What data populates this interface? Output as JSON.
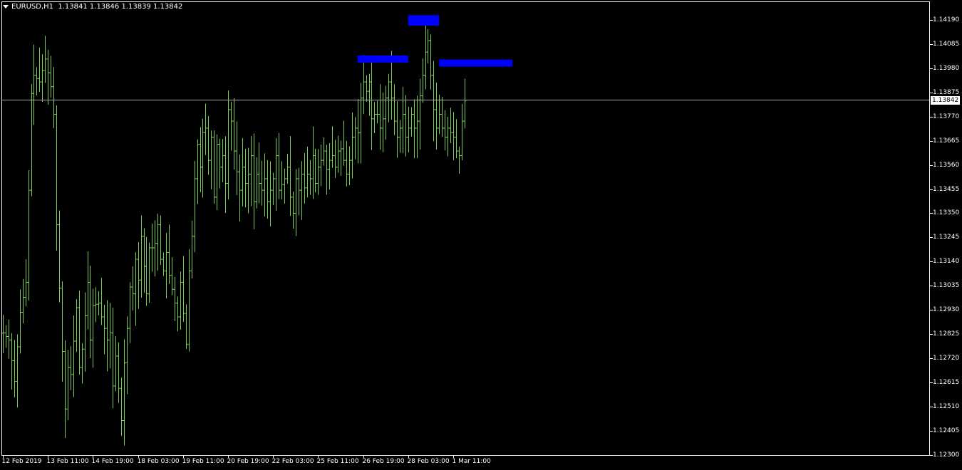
{
  "header": {
    "symbol": "EURUSD,H1",
    "quote": "1.13841 1.13846 1.13839 1.13842"
  },
  "current_price_label": "1.13842",
  "colors": {
    "background": "#000000",
    "bars": "#7ccc5c",
    "zones": "#0000ff",
    "axis": "#ffffff",
    "price_line": "#a8a8a8"
  },
  "chart_data": {
    "type": "bar",
    "title": "EURUSD,H1",
    "ylim": [
      1.123,
      1.1427
    ],
    "yticks": [
      "1.14190",
      "1.14085",
      "1.13980",
      "1.13875",
      "1.13770",
      "1.13665",
      "1.13560",
      "1.13455",
      "1.13350",
      "1.13245",
      "1.13140",
      "1.13035",
      "1.12930",
      "1.12825",
      "1.12720",
      "1.12615",
      "1.12510",
      "1.12405",
      "1.12300"
    ],
    "xticks": [
      "12 Feb 2019",
      "13 Feb 11:00",
      "14 Feb 19:00",
      "18 Feb 03:00",
      "19 Feb 11:00",
      "20 Feb 19:00",
      "22 Feb 03:00",
      "25 Feb 11:00",
      "26 Feb 19:00",
      "28 Feb 03:00",
      "1 Mar 11:00"
    ],
    "current_price": 1.13842,
    "zones": [
      {
        "from_bar": 126,
        "to_bar": 144,
        "low": 1.14015,
        "high": 1.14025
      },
      {
        "from_bar": 144,
        "to_bar": 155,
        "low": 1.14165,
        "high": 1.1421
      },
      {
        "from_bar": 155,
        "to_bar": 181,
        "low": 1.13995,
        "high": 1.1401
      }
    ],
    "anchors": [
      [
        0,
        1.1283
      ],
      [
        2,
        1.128
      ],
      [
        4,
        1.1262
      ],
      [
        6,
        1.1292
      ],
      [
        8,
        1.1305
      ],
      [
        9,
        1.1345
      ],
      [
        10,
        1.1387
      ],
      [
        11,
        1.1395
      ],
      [
        13,
        1.1392
      ],
      [
        15,
        1.1402
      ],
      [
        17,
        1.139
      ],
      [
        18,
        1.1378
      ],
      [
        19,
        1.133
      ],
      [
        21,
        1.1275
      ],
      [
        22,
        1.125
      ],
      [
        23,
        1.1268
      ],
      [
        24,
        1.1265
      ],
      [
        26,
        1.1294
      ],
      [
        27,
        1.1268
      ],
      [
        28,
        1.1276
      ],
      [
        30,
        1.1305
      ],
      [
        31,
        1.128
      ],
      [
        32,
        1.1295
      ],
      [
        34,
        1.1296
      ],
      [
        35,
        1.129
      ],
      [
        36,
        1.1285
      ],
      [
        37,
        1.128
      ],
      [
        38,
        1.1283
      ],
      [
        39,
        1.126
      ],
      [
        40,
        1.1273
      ],
      [
        42,
        1.1245
      ],
      [
        43,
        1.127
      ],
      [
        44,
        1.1285
      ],
      [
        45,
        1.1303
      ],
      [
        46,
        1.13
      ],
      [
        47,
        1.1315
      ],
      [
        48,
        1.1306
      ],
      [
        49,
        1.1325
      ],
      [
        50,
        1.1312
      ],
      [
        51,
        1.13
      ],
      [
        52,
        1.132
      ],
      [
        53,
        1.132
      ],
      [
        54,
        1.1322
      ],
      [
        55,
        1.133
      ],
      [
        56,
        1.1315
      ],
      [
        57,
        1.131
      ],
      [
        58,
        1.1318
      ],
      [
        59,
        1.1308
      ],
      [
        60,
        1.1302
      ],
      [
        62,
        1.129
      ],
      [
        63,
        1.1305
      ],
      [
        65,
        1.1278
      ],
      [
        66,
        1.131
      ],
      [
        67,
        1.1325
      ],
      [
        68,
        1.135
      ],
      [
        69,
        1.1365
      ],
      [
        70,
        1.1355
      ],
      [
        71,
        1.137
      ],
      [
        72,
        1.1372
      ],
      [
        73,
        1.1358
      ],
      [
        74,
        1.1368
      ],
      [
        75,
        1.1342
      ],
      [
        76,
        1.1365
      ],
      [
        77,
        1.1355
      ],
      [
        78,
        1.136
      ],
      [
        79,
        1.1348
      ],
      [
        80,
        1.138
      ],
      [
        81,
        1.1375
      ],
      [
        82,
        1.1362
      ],
      [
        83,
        1.1353
      ],
      [
        84,
        1.1345
      ],
      [
        85,
        1.1355
      ],
      [
        86,
        1.1348
      ],
      [
        87,
        1.1352
      ],
      [
        88,
        1.136
      ],
      [
        89,
        1.134
      ],
      [
        90,
        1.1352
      ],
      [
        91,
        1.1348
      ],
      [
        92,
        1.1345
      ],
      [
        93,
        1.135
      ],
      [
        94,
        1.134
      ],
      [
        95,
        1.1345
      ],
      [
        96,
        1.135
      ],
      [
        97,
        1.136
      ],
      [
        98,
        1.1345
      ],
      [
        100,
        1.135
      ],
      [
        101,
        1.1355
      ],
      [
        102,
        1.1342
      ],
      [
        103,
        1.1335
      ],
      [
        104,
        1.135
      ],
      [
        105,
        1.1345
      ],
      [
        106,
        1.1352
      ],
      [
        107,
        1.1346
      ],
      [
        108,
        1.1352
      ],
      [
        109,
        1.135
      ],
      [
        110,
        1.136
      ],
      [
        111,
        1.1348
      ],
      [
        112,
        1.1355
      ],
      [
        113,
        1.1358
      ],
      [
        114,
        1.1362
      ],
      [
        115,
        1.1354
      ],
      [
        116,
        1.1358
      ],
      [
        117,
        1.136
      ],
      [
        118,
        1.1355
      ],
      [
        119,
        1.1362
      ],
      [
        120,
        1.1363
      ],
      [
        121,
        1.1358
      ],
      [
        122,
        1.1352
      ],
      [
        123,
        1.1358
      ],
      [
        124,
        1.1368
      ],
      [
        125,
        1.1372
      ],
      [
        126,
        1.137
      ],
      [
        127,
        1.1385
      ],
      [
        128,
        1.1392
      ],
      [
        129,
        1.1388
      ],
      [
        130,
        1.1392
      ],
      [
        131,
        1.1376
      ],
      [
        132,
        1.1378
      ],
      [
        133,
        1.1378
      ],
      [
        134,
        1.1372
      ],
      [
        135,
        1.1376
      ],
      [
        136,
        1.1385
      ],
      [
        137,
        1.1392
      ],
      [
        138,
        1.1385
      ],
      [
        139,
        1.1375
      ],
      [
        140,
        1.1368
      ],
      [
        141,
        1.1372
      ],
      [
        142,
        1.1378
      ],
      [
        143,
        1.1368
      ],
      [
        144,
        1.1372
      ],
      [
        145,
        1.1378
      ],
      [
        146,
        1.1372
      ],
      [
        147,
        1.1375
      ],
      [
        148,
        1.1386
      ],
      [
        149,
        1.1395
      ],
      [
        150,
        1.1405
      ],
      [
        151,
        1.141
      ],
      [
        152,
        1.1395
      ],
      [
        153,
        1.138
      ],
      [
        154,
        1.1372
      ],
      [
        155,
        1.1378
      ],
      [
        156,
        1.1372
      ],
      [
        157,
        1.1368
      ],
      [
        158,
        1.1372
      ],
      [
        159,
        1.137
      ],
      [
        160,
        1.1368
      ],
      [
        161,
        1.1362
      ],
      [
        162,
        1.136
      ],
      [
        163,
        1.1375
      ],
      [
        164,
        1.1384
      ]
    ]
  }
}
